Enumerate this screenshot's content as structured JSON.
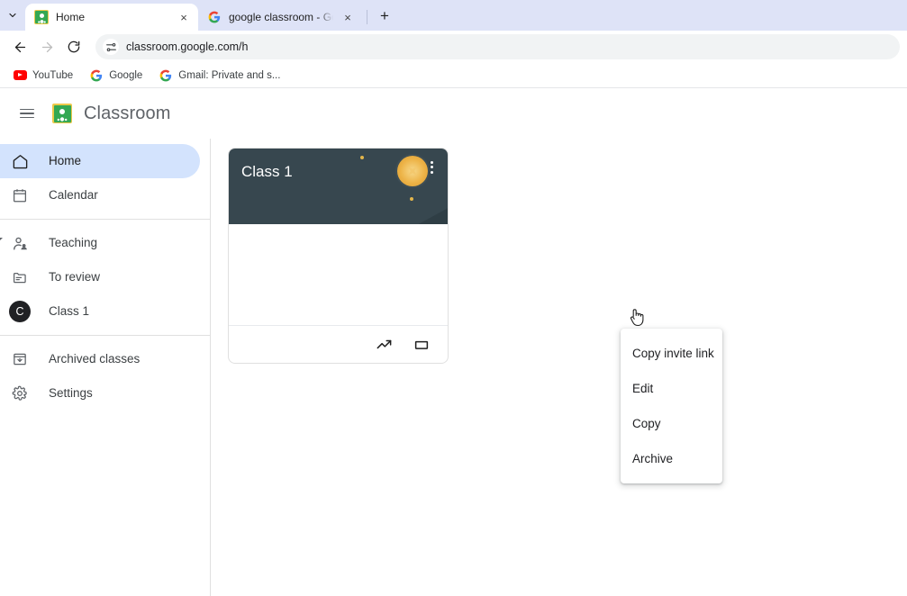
{
  "browser": {
    "tabs": [
      {
        "title": "Home",
        "favicon": "classroom-favicon",
        "active": true
      },
      {
        "title": "google classroom - Google Sea",
        "favicon": "google-favicon",
        "active": false
      }
    ],
    "new_tab_label": "+",
    "close_label": "×",
    "nav": {
      "back": "←",
      "forward": "→",
      "reload": "⟳"
    },
    "omnibox": {
      "url": "classroom.google.com/h",
      "icon": "page-settings-icon"
    },
    "bookmarks": [
      {
        "label": "YouTube",
        "icon": "youtube-icon"
      },
      {
        "label": "Google",
        "icon": "google-icon"
      },
      {
        "label": "Gmail: Private and s...",
        "icon": "google-icon"
      }
    ]
  },
  "app": {
    "brand": "Classroom",
    "menu_icon": "hamburger-icon",
    "logo_icon": "classroom-logo-icon"
  },
  "sidebar": {
    "groups": [
      {
        "items": [
          {
            "label": "Home",
            "icon": "home-icon",
            "active": true
          },
          {
            "label": "Calendar",
            "icon": "calendar-icon",
            "active": false
          }
        ]
      },
      {
        "items": [
          {
            "label": "Teaching",
            "icon": "teaching-icon",
            "active": false,
            "expandable": true
          },
          {
            "label": "To review",
            "icon": "to-review-icon",
            "active": false
          },
          {
            "label": "Class 1",
            "icon": "class-avatar",
            "avatar": "C",
            "active": false
          }
        ]
      },
      {
        "items": [
          {
            "label": "Archived classes",
            "icon": "archive-icon",
            "active": false
          },
          {
            "label": "Settings",
            "icon": "gear-icon",
            "active": false
          }
        ]
      }
    ]
  },
  "main": {
    "class_card": {
      "title": "Class 1",
      "kebab_label": "class-options",
      "banner_color": "#37474f",
      "accent_color": "#edb347",
      "actions": [
        {
          "icon": "trending-up-icon",
          "name": "open-classwork"
        },
        {
          "icon": "folder-icon",
          "name": "open-folder"
        }
      ]
    }
  },
  "context_menu": {
    "items": [
      {
        "label": "Copy invite link"
      },
      {
        "label": "Edit"
      },
      {
        "label": "Copy"
      },
      {
        "label": "Archive"
      }
    ]
  }
}
